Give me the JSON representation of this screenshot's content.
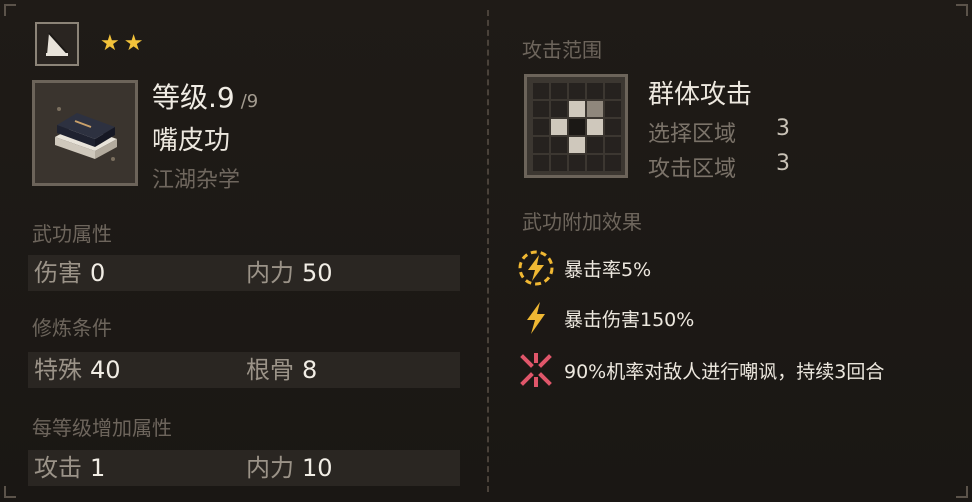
{
  "skill": {
    "stars": "★★",
    "level_label": "等级.9",
    "level_max": "/9",
    "name": "嘴皮功",
    "category": "江湖杂学"
  },
  "sections": {
    "attributes_title": "武功属性",
    "requirements_title": "修炼条件",
    "per_level_title": "每等级增加属性"
  },
  "attributes": [
    {
      "label": "伤害",
      "value": "0"
    },
    {
      "label": "内力",
      "value": "50"
    }
  ],
  "requirements": [
    {
      "label": "特殊",
      "value": "40"
    },
    {
      "label": "根骨",
      "value": "8"
    }
  ],
  "per_level": [
    {
      "label": "攻击",
      "value": "1"
    },
    {
      "label": "内力",
      "value": "10"
    }
  ],
  "range": {
    "title": "攻击范围",
    "type": "群体攻击",
    "select_label": "选择区域",
    "select_value": "3",
    "attack_label": "攻击区域",
    "attack_value": "3"
  },
  "effects_title": "武功附加效果",
  "effects": [
    {
      "icon": "lightning-circle-icon",
      "text": "暴击率5%"
    },
    {
      "icon": "lightning-icon",
      "text": "暴击伤害150%"
    },
    {
      "icon": "taunt-cross-icon",
      "text": "90%机率对敌人进行嘲讽，持续3回合"
    }
  ],
  "colors": {
    "star": "#f2c23a",
    "lightning": "#f0b833",
    "taunt": "#e0566a"
  }
}
